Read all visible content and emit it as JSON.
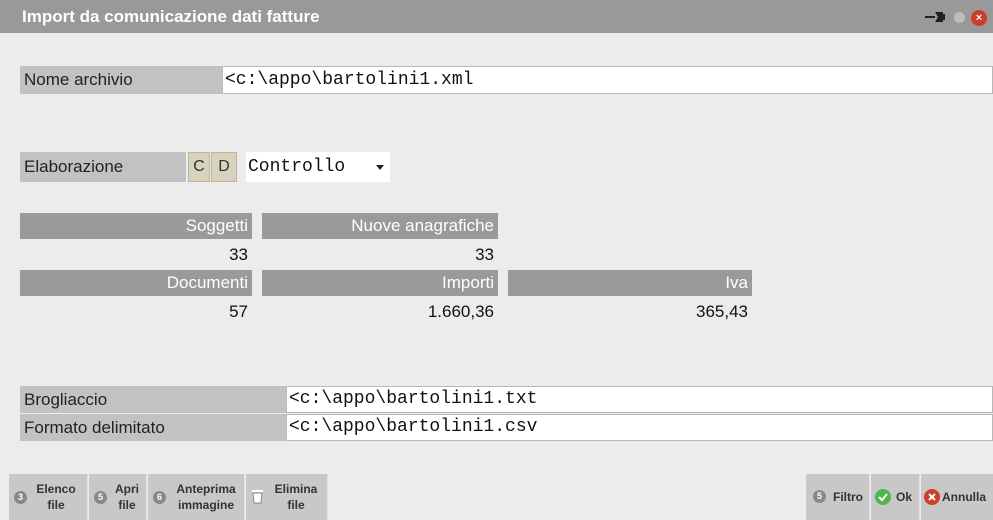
{
  "window": {
    "title": "Import da comunicazione dati fatture"
  },
  "form": {
    "nome_archivio": {
      "label": "Nome archivio",
      "value": "<c:\\appo\\bartolini1.xml"
    },
    "elaborazione": {
      "label": "Elaborazione",
      "toggle_c": "C",
      "toggle_d": "D",
      "selected": "Controllo"
    },
    "brogliaccio": {
      "label": "Brogliaccio",
      "value": "<c:\\appo\\bartolini1.txt"
    },
    "formato_delimitato": {
      "label": "Formato delimitato",
      "value": "<c:\\appo\\bartolini1.csv"
    }
  },
  "stats": {
    "soggetti": {
      "label": "Soggetti",
      "value": "33"
    },
    "nuove_anagrafiche": {
      "label": "Nuove anagrafiche",
      "value": "33"
    },
    "documenti": {
      "label": "Documenti",
      "value": "57"
    },
    "importi": {
      "label": "Importi",
      "value": "1.660,36"
    },
    "iva": {
      "label": "Iva",
      "value": "365,43"
    }
  },
  "toolbar": {
    "elenco_file": {
      "key": "3",
      "line1": "Elenco",
      "line2": "file"
    },
    "apri_file": {
      "key": "5",
      "line1": "Apri",
      "line2": "file"
    },
    "anteprima": {
      "key": "6",
      "line1": "Anteprima",
      "line2": "immagine"
    },
    "elimina_file": {
      "line1": "Elimina",
      "line2": "file"
    },
    "filtro": {
      "key": "5",
      "label": "Filtro"
    },
    "ok": {
      "label": "Ok"
    },
    "annulla": {
      "label": "Annulla"
    }
  },
  "colors": {
    "title_bar": "#999999",
    "header_fill": "#9a9a9a",
    "label_fill": "#c2c2c2",
    "ok_green": "#4cb84c",
    "cancel_red": "#d23a2a"
  }
}
